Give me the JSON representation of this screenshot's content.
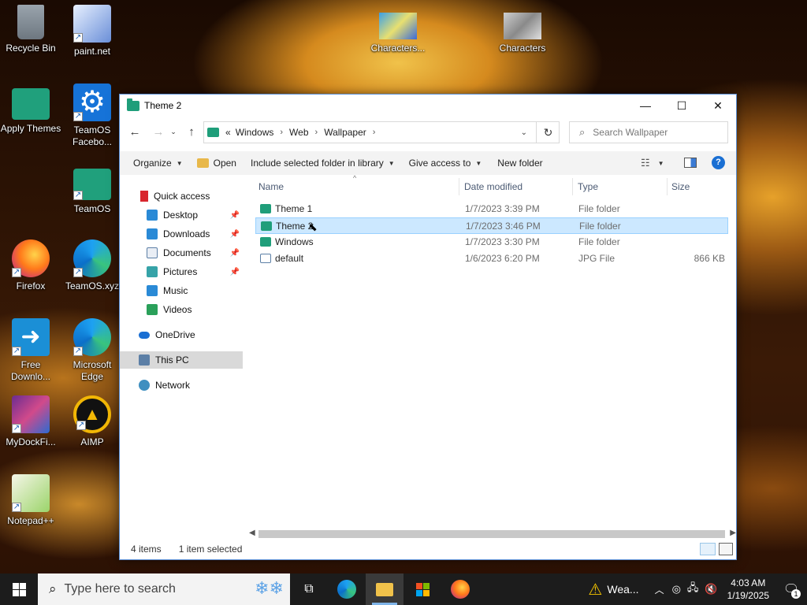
{
  "desktop": {
    "icons": [
      {
        "label": "Recycle Bin",
        "icon": "recycle-bin-icon"
      },
      {
        "label": "paint.net",
        "icon": "paintnet-icon"
      },
      {
        "label": "Apply Themes",
        "icon": "folder-icon"
      },
      {
        "label": "TeamOS Facebo...",
        "icon": "gear-icon"
      },
      {
        "label": "TeamOS",
        "icon": "folder-icon"
      },
      {
        "label": "Firefox",
        "icon": "firefox-icon"
      },
      {
        "label": "TeamOS.xyz",
        "icon": "edge-icon"
      },
      {
        "label": "Free Downlo...",
        "icon": "download-arrow-icon"
      },
      {
        "label": "Microsoft Edge",
        "icon": "edge-icon"
      },
      {
        "label": "MyDockFi...",
        "icon": "dock-icon"
      },
      {
        "label": "AIMP",
        "icon": "aimp-icon"
      },
      {
        "label": "Notepad++",
        "icon": "notepadpp-icon"
      },
      {
        "label": "Characters...",
        "icon": "image-thumbnail-icon"
      },
      {
        "label": "Characters",
        "icon": "image-thumbnail-icon"
      }
    ]
  },
  "window": {
    "title": "Theme 2",
    "address": {
      "overflow": "«",
      "crumbs": [
        "Windows",
        "Web",
        "Wallpaper"
      ]
    },
    "search_placeholder": "Search Wallpaper",
    "toolbar": {
      "organize": "Organize",
      "open": "Open",
      "include": "Include selected folder in library",
      "give_access": "Give access to",
      "new_folder": "New folder"
    },
    "nav": {
      "quick_access": "Quick access",
      "desktop": "Desktop",
      "downloads": "Downloads",
      "documents": "Documents",
      "pictures": "Pictures",
      "music": "Music",
      "videos": "Videos",
      "onedrive": "OneDrive",
      "this_pc": "This PC",
      "network": "Network"
    },
    "columns": {
      "name": "Name",
      "date": "Date modified",
      "type": "Type",
      "size": "Size"
    },
    "files": [
      {
        "name": "Theme 1",
        "date": "1/7/2023 3:39 PM",
        "type": "File folder",
        "size": ""
      },
      {
        "name": "Theme 2",
        "date": "1/7/2023 3:46 PM",
        "type": "File folder",
        "size": ""
      },
      {
        "name": "Windows",
        "date": "1/7/2023 3:30 PM",
        "type": "File folder",
        "size": ""
      },
      {
        "name": "default",
        "date": "1/6/2023 6:20 PM",
        "type": "JPG File",
        "size": "866 KB"
      }
    ],
    "status": {
      "count": "4 items",
      "selection": "1 item selected"
    }
  },
  "taskbar": {
    "search_placeholder": "Type here to search",
    "weather": "Wea...",
    "time": "4:03 AM",
    "date": "1/19/2025",
    "notification_count": "1"
  }
}
